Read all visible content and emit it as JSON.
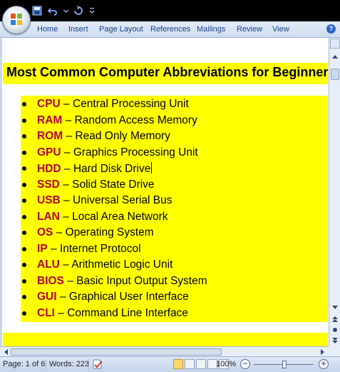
{
  "ribbon": {
    "tabs": [
      "Home",
      "Insert",
      "Page Layout",
      "References",
      "Mailings",
      "Review",
      "View"
    ]
  },
  "document": {
    "title": "Most Common Computer Abbreviations for Beginners",
    "items": [
      {
        "abbr": "CPU",
        "meaning": " – Central Processing Unit"
      },
      {
        "abbr": "RAM",
        "meaning": " – Random Access Memory"
      },
      {
        "abbr": "ROM",
        "meaning": " – Read Only Memory"
      },
      {
        "abbr": "GPU",
        "meaning": " – Graphics Processing Unit"
      },
      {
        "abbr": "HDD",
        "meaning": " – Hard Disk Drive"
      },
      {
        "abbr": "SSD",
        "meaning": " – Solid State Drive"
      },
      {
        "abbr": "USB",
        "meaning": " – Universal Serial Bus"
      },
      {
        "abbr": "LAN",
        "meaning": " – Local Area Network"
      },
      {
        "abbr": "OS",
        "meaning": " – Operating System"
      },
      {
        "abbr": "IP",
        "meaning": " – Internet Protocol"
      },
      {
        "abbr": "ALU",
        "meaning": " – Arithmetic Logic Unit"
      },
      {
        "abbr": "BIOS",
        "meaning": " – Basic Input Output System"
      },
      {
        "abbr": "GUI",
        "meaning": " – Graphical User Interface"
      },
      {
        "abbr": "CLI",
        "meaning": " – Command Line Interface"
      }
    ],
    "cursor_item_index": 4
  },
  "statusbar": {
    "page": "Page: 1 of 6",
    "words": "Words: 223",
    "zoom": "100%"
  },
  "colors": {
    "highlight": "#ffff00",
    "abbr": "#b2003a",
    "titlebar": "#000000",
    "ribbon_text": "#15428b"
  },
  "icons": [
    "office-button-icon",
    "save-icon",
    "undo-icon",
    "redo-icon",
    "customize-qat-icon",
    "help-icon",
    "spell-check-icon"
  ]
}
